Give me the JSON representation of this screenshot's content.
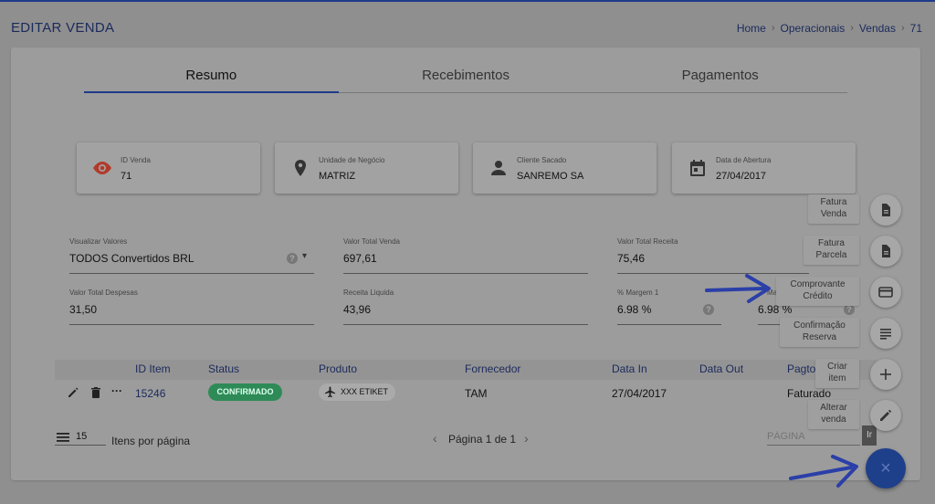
{
  "header": {
    "title": "EDITAR VENDA",
    "breadcrumb": [
      "Home",
      "Operacionais",
      "Vendas",
      "71"
    ],
    "breadcrumb_sep": "›"
  },
  "tabs": [
    {
      "label": "Resumo",
      "active": true
    },
    {
      "label": "Recebimentos",
      "active": false
    },
    {
      "label": "Pagamentos",
      "active": false
    }
  ],
  "info_cards": [
    {
      "label": "ID Venda",
      "value": "71",
      "icon": "eye-icon",
      "icon_color": "#c0392b"
    },
    {
      "label": "Unidade de Negócio",
      "value": "MATRIZ",
      "icon": "location-pin-icon"
    },
    {
      "label": "Cliente Sacado",
      "value": "SANREMO SA",
      "icon": "person-icon"
    },
    {
      "label": "Data de Abertura",
      "value": "27/04/2017",
      "icon": "calendar-icon"
    }
  ],
  "fields": {
    "visualizar_valores": {
      "label": "Visualizar Valores",
      "value": "TODOS Convertidos BRL"
    },
    "valor_total_venda": {
      "label": "Valor Total Venda",
      "value": "697,61"
    },
    "valor_total_receita": {
      "label": "Valor Total Receita",
      "value": "75,46"
    },
    "valor_total_despesas": {
      "label": "Valor Total Despesas",
      "value": "31,50"
    },
    "receita_liquida": {
      "label": "Receita Liquida",
      "value": "43,96"
    },
    "margem_1": {
      "label": "% Margem 1",
      "value": "6.98 %"
    },
    "margem_2": {
      "label": "Ma",
      "value": "6.98 %"
    }
  },
  "help_glyph": "?",
  "dropdown_glyph": "▾",
  "table": {
    "columns": [
      "ID Item",
      "Status",
      "Produto",
      "Fornecedor",
      "Data In",
      "Data Out",
      "Pagto"
    ],
    "row": {
      "actions_more": "···",
      "id_item": "15246",
      "status": "CONFIRMADO",
      "produto": "XXX ETIKET",
      "fornecedor": "TAM",
      "data_in": "27/04/2017",
      "data_out": "",
      "pagto": "Faturado"
    }
  },
  "pagination": {
    "page_size": "15",
    "page_size_label": "Itens por página",
    "page_label": "Página 1 de 1",
    "prev": "‹",
    "next": "›",
    "goto_placeholder": "PÁGINA",
    "goto_button": "Ir"
  },
  "fab_menu": [
    {
      "tooltip_l1": "Fatura",
      "tooltip_l2": "Venda",
      "icon": "document-icon"
    },
    {
      "tooltip_l1": "Fatura",
      "tooltip_l2": "Parcela",
      "icon": "document-icon"
    },
    {
      "tooltip_l1": "Comprovante",
      "tooltip_l2": "Crédito",
      "icon": "credit-card-icon"
    },
    {
      "tooltip_l1": "Confirmação",
      "tooltip_l2": "Reserva",
      "icon": "notes-icon"
    },
    {
      "tooltip_l1": "Criar",
      "tooltip_l2": "item",
      "icon": "plus-icon"
    },
    {
      "tooltip_l1": "Alterar",
      "tooltip_l2": "venda",
      "icon": "pencil-icon"
    }
  ],
  "fab_main_glyph": "×",
  "colors": {
    "accent": "#1f3a8a",
    "status_green": "#2e8b57",
    "annotation_arrow": "#2b3fa8"
  }
}
